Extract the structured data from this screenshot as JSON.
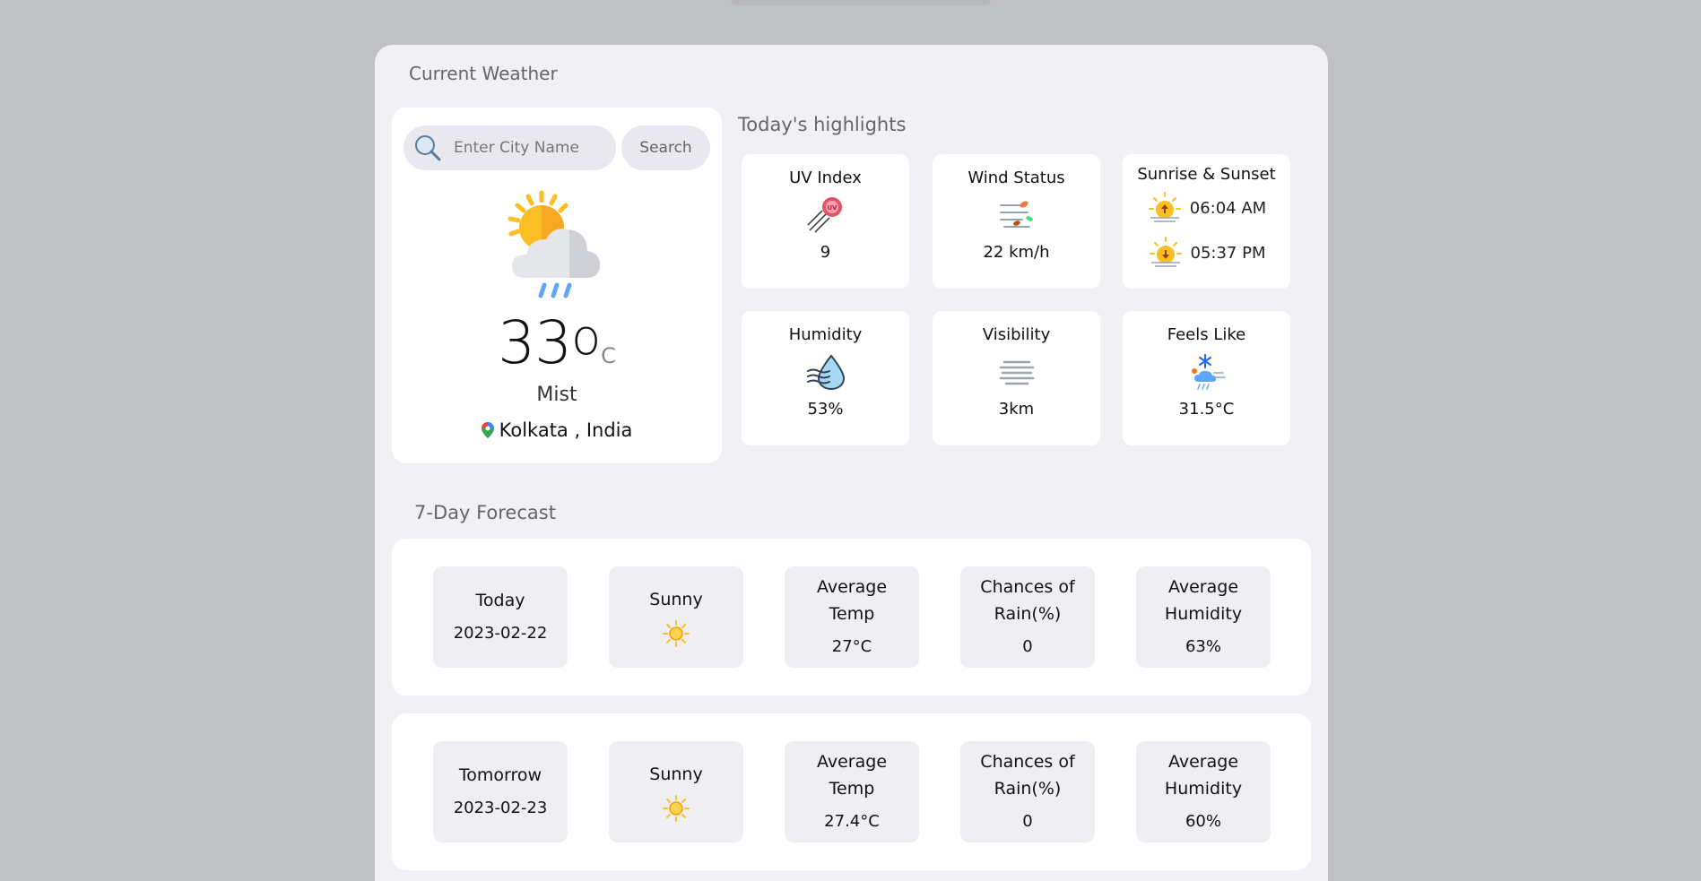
{
  "header": {
    "title": "Current Weather"
  },
  "search": {
    "placeholder": "Enter City Name",
    "button_label": "Search"
  },
  "current": {
    "temperature": "33",
    "degree": "o",
    "unit": "C",
    "condition": "Mist",
    "location": "Kolkata , India",
    "icon": "sun-cloud-rain-icon"
  },
  "highlights": {
    "title": "Today's highlights",
    "uv": {
      "label": "UV Index",
      "value": "9",
      "icon": "uv-icon"
    },
    "wind": {
      "label": "Wind Status",
      "value": "22 km/h",
      "icon": "wind-icon"
    },
    "sun": {
      "label": "Sunrise & Sunset",
      "sunrise": "06:04 AM",
      "sunset": "05:37 PM"
    },
    "humidity": {
      "label": "Humidity",
      "value": "53%",
      "icon": "humidity-drop-icon"
    },
    "visibility": {
      "label": "Visibility",
      "value": "3km",
      "icon": "fog-icon"
    },
    "feels_like": {
      "label": "Feels Like",
      "value": "31.5°C",
      "icon": "snow-cloud-icon"
    }
  },
  "forecast": {
    "title": "7-Day Forecast",
    "days": [
      {
        "day": "Today",
        "date": "2023-02-22",
        "condition": "Sunny",
        "avg_temp_label": "Average Temp",
        "avg_temp": "27°C",
        "rain_label": "Chances of Rain(%)",
        "rain": "0",
        "humidity_label": "Average Humidity",
        "humidity": "63%"
      },
      {
        "day": "Tomorrow",
        "date": "2023-02-23",
        "condition": "Sunny",
        "avg_temp_label": "Average Temp",
        "avg_temp": "27.4°C",
        "rain_label": "Chances of Rain(%)",
        "rain": "0",
        "humidity_label": "Average Humidity",
        "humidity": "60%"
      }
    ]
  },
  "colors": {
    "background": "#c0c1c5",
    "panel": "#f1f1f5",
    "card": "#ffffff",
    "sun": "#fbbf24"
  }
}
